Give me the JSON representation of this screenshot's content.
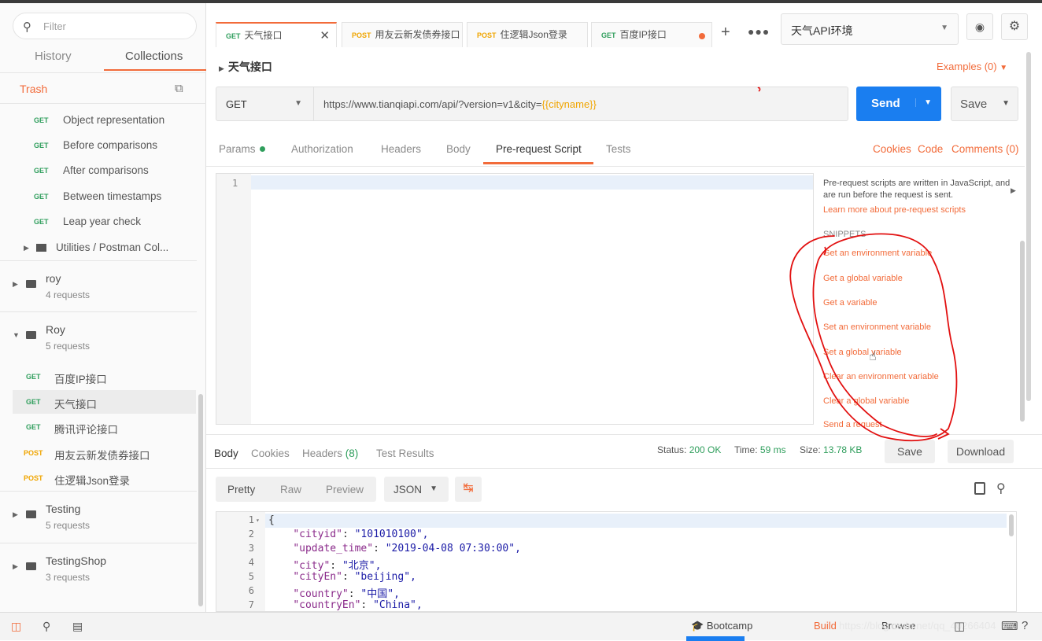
{
  "sidebar": {
    "filter_placeholder": "Filter",
    "tabs": [
      "History",
      "Collections"
    ],
    "trash": "Trash",
    "requests_top": [
      {
        "method": "GET",
        "label": "Object representation"
      },
      {
        "method": "GET",
        "label": "Before comparisons"
      },
      {
        "method": "GET",
        "label": "After comparisons"
      },
      {
        "method": "GET",
        "label": "Between timestamps"
      },
      {
        "method": "GET",
        "label": "Leap year check"
      }
    ],
    "utilities": "Utilities / Postman Col...",
    "folders": [
      {
        "name": "roy",
        "count": "4 requests"
      },
      {
        "name": "Roy",
        "count": "5 requests"
      },
      {
        "name": "Testing",
        "count": "5 requests"
      },
      {
        "name": "TestingShop",
        "count": "3 requests"
      }
    ],
    "roy_requests": [
      {
        "method": "GET",
        "label": "百度IP接口"
      },
      {
        "method": "GET",
        "label": "天气接口"
      },
      {
        "method": "GET",
        "label": "腾讯评论接口"
      },
      {
        "method": "POST",
        "label": "用友云新发债券接口"
      },
      {
        "method": "POST",
        "label": "住逻辑Json登录"
      }
    ]
  },
  "tabs": [
    {
      "method": "GET",
      "label": "天气接口",
      "close": "✕"
    },
    {
      "method": "POST",
      "label": "用友云新发债券接口"
    },
    {
      "method": "POST",
      "label": "住逻辑Json登录"
    },
    {
      "method": "GET",
      "label": "百度IP接口"
    }
  ],
  "env": {
    "selected": "天气API环境"
  },
  "breadcrumb": "天气接口",
  "examples": "Examples (0)",
  "request": {
    "method": "GET",
    "url_prefix": "https://www.tianqiapi.com/api/?version=v1&city=",
    "url_var": "{{cityname}}",
    "send": "Send",
    "save": "Save"
  },
  "req_tabs": [
    "Params",
    "Authorization",
    "Headers",
    "Body",
    "Pre-request Script",
    "Tests"
  ],
  "req_links": [
    "Cookies",
    "Code",
    "Comments (0)"
  ],
  "editor": {
    "line": "1"
  },
  "side_panel": {
    "desc": "Pre-request scripts are written in JavaScript, and are run before the request is sent.",
    "learn": "Learn more about pre-request scripts",
    "snippets_header": "SNIPPETS",
    "snippets": [
      "Get an environment variable",
      "Get a global variable",
      "Get a variable",
      "Set an environment variable",
      "Set a global variable",
      "Clear an environment variable",
      "Clear a global variable",
      "Send a request"
    ]
  },
  "response": {
    "tabs": [
      "Body",
      "Cookies",
      "Headers",
      "Test Results"
    ],
    "headers_count": "(8)",
    "status_label": "Status:",
    "status": "200 OK",
    "time_label": "Time:",
    "time": "59 ms",
    "size_label": "Size:",
    "size": "13.78 KB",
    "save": "Save",
    "download": "Download",
    "views": [
      "Pretty",
      "Raw",
      "Preview"
    ],
    "format": "JSON"
  },
  "json_lines": [
    {
      "n": "1",
      "text": "{"
    },
    {
      "n": "2",
      "key": "\"cityid\"",
      "val": "\"101010100\","
    },
    {
      "n": "3",
      "key": "\"update_time\"",
      "val": "\"2019-04-08 07:30:00\","
    },
    {
      "n": "4",
      "key": "\"city\"",
      "val": "\"北京\","
    },
    {
      "n": "5",
      "key": "\"cityEn\"",
      "val": "\"beijing\","
    },
    {
      "n": "6",
      "key": "\"country\"",
      "val": "\"中国\","
    },
    {
      "n": "7",
      "key": "\"countryEn\"",
      "val": "\"China\","
    }
  ],
  "statusbar": {
    "bootcamp": "Bootcamp",
    "build": "Build",
    "browse": "Browse",
    "watermark": "https://blog.csdn.net/qq_40266404"
  },
  "colors": {
    "accent": "#f26b3a",
    "send": "#1a7ef0",
    "get": "#2f9e5c",
    "post": "#f0a500"
  }
}
